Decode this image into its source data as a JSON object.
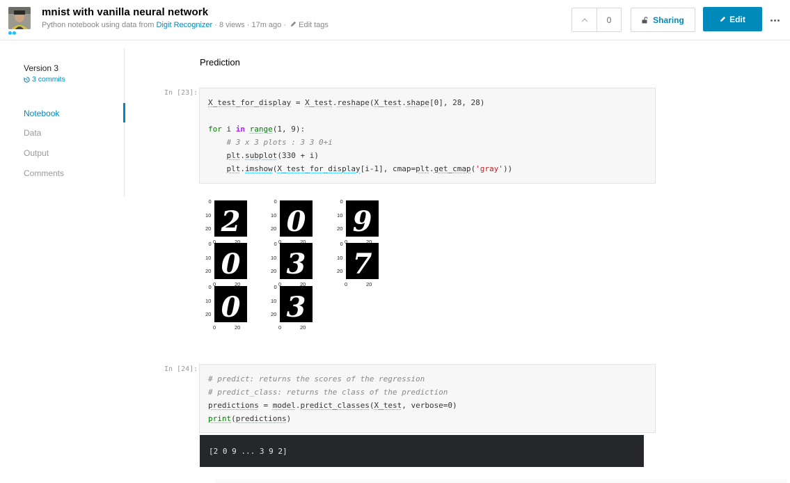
{
  "header": {
    "title": "mnist with vanilla neural network",
    "subtitle_prefix": "Python notebook using data from",
    "dataset_link": "Digit Recognizer",
    "meta": "· 8 views · 17m ago ·",
    "edit_tags": "Edit tags",
    "vote_count": "0",
    "sharing_label": "Sharing",
    "edit_label": "Edit"
  },
  "sidebar": {
    "version": "Version 3",
    "commits": "3 commits",
    "items": [
      {
        "label": "Notebook",
        "active": true
      },
      {
        "label": "Data",
        "active": false
      },
      {
        "label": "Output",
        "active": false
      },
      {
        "label": "Comments",
        "active": false
      }
    ]
  },
  "main": {
    "section_heading": "Prediction",
    "cell1_prompt": "In [23]:",
    "cell2_prompt": "In [24]:",
    "output_text": "[2 0 9 ... 3 9 2]"
  },
  "plots": {
    "ticks_y": [
      "0",
      "10",
      "20"
    ],
    "ticks_x": [
      "0",
      "20"
    ],
    "digits": [
      "2",
      "0",
      "9",
      "0",
      "3",
      "7",
      "0",
      "3"
    ]
  },
  "colors": {
    "accent": "#008abc",
    "kaggle_blue": "#20beff",
    "output_bg": "#25272b"
  }
}
